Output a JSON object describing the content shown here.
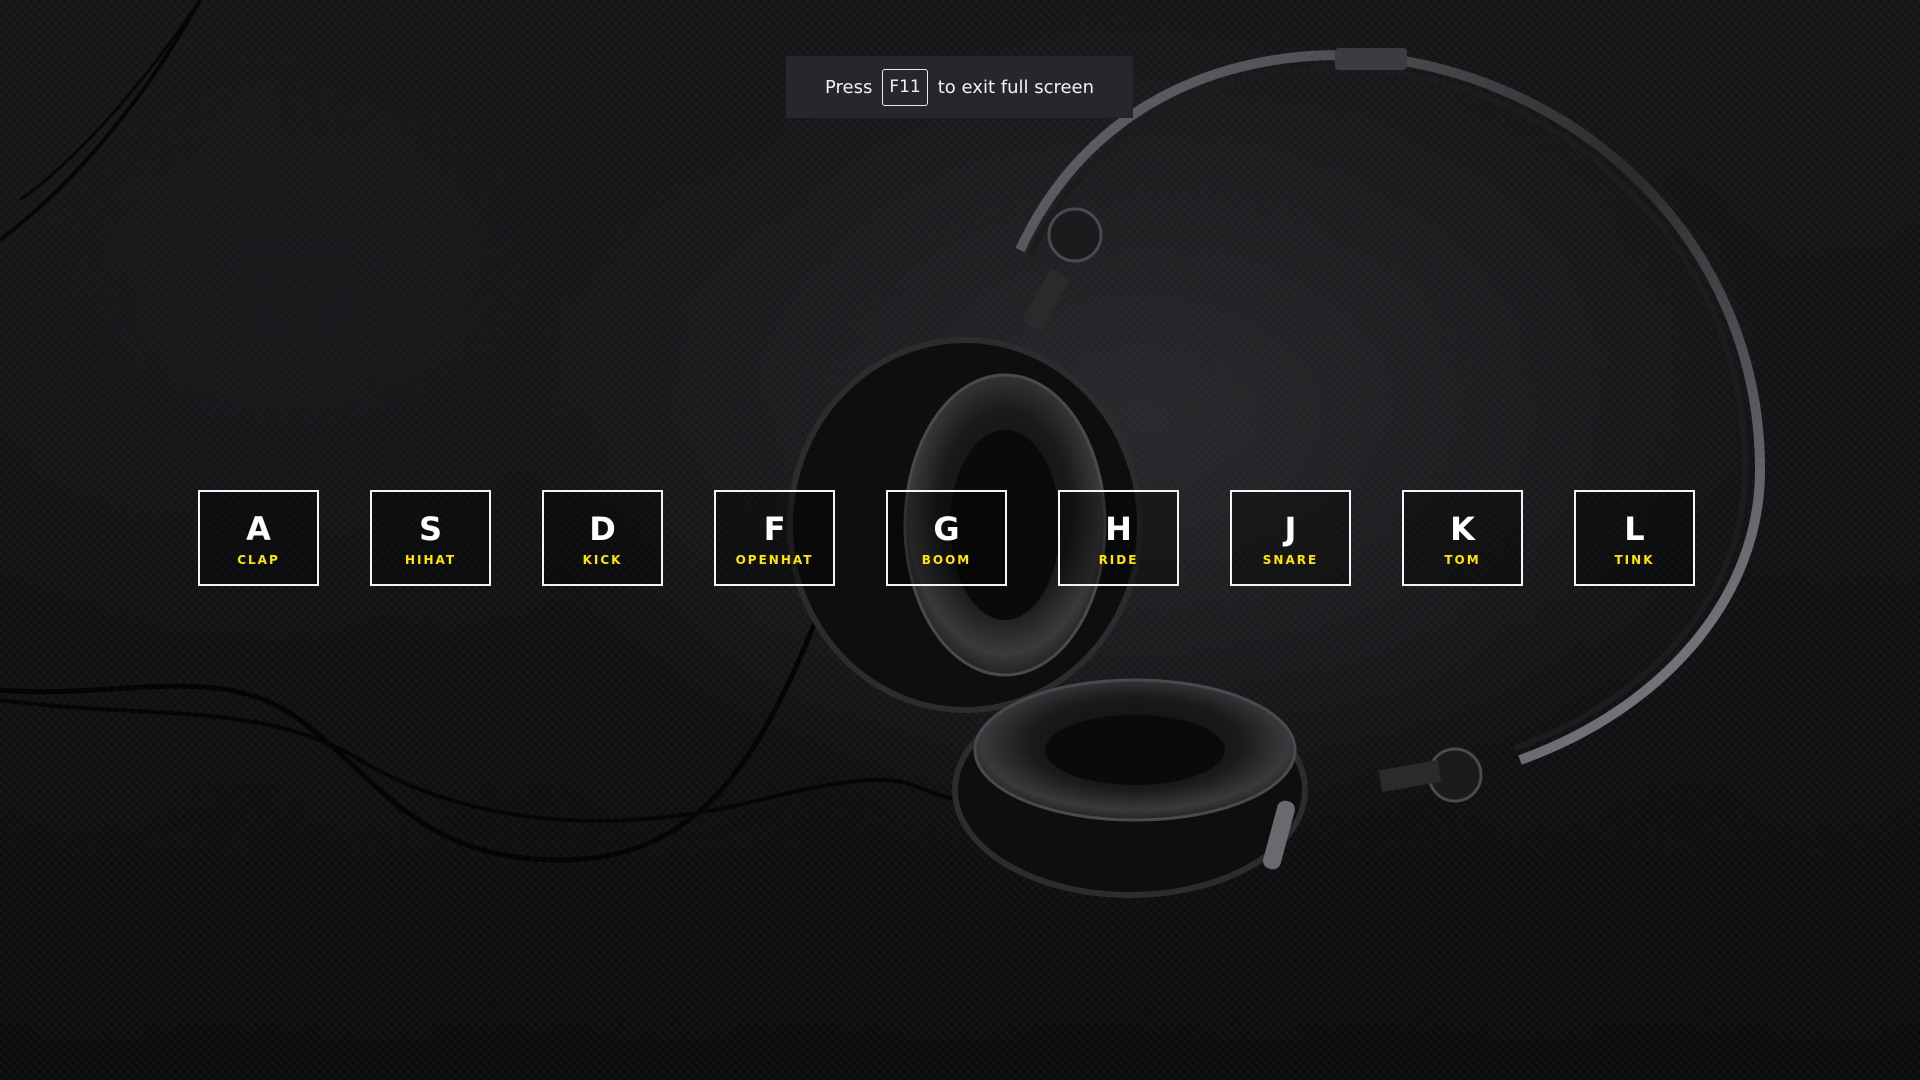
{
  "fullscreen_banner": {
    "prefix": "Press",
    "key": "F11",
    "suffix": "to exit full screen"
  },
  "drum_keys": [
    {
      "letter": "A",
      "sound": "CLAP"
    },
    {
      "letter": "S",
      "sound": "HIHAT"
    },
    {
      "letter": "D",
      "sound": "KICK"
    },
    {
      "letter": "F",
      "sound": "OPENHAT"
    },
    {
      "letter": "G",
      "sound": "BOOM"
    },
    {
      "letter": "H",
      "sound": "RIDE"
    },
    {
      "letter": "J",
      "sound": "SNARE"
    },
    {
      "letter": "K",
      "sound": "TOM"
    },
    {
      "letter": "L",
      "sound": "TINK"
    }
  ],
  "colors": {
    "key_border": "#f4f4f4",
    "key_letter": "#ffffff",
    "sound_label": "#ffe600",
    "banner_bg": "#25272b",
    "background": "#111214"
  },
  "background_image": "headphones-photo"
}
